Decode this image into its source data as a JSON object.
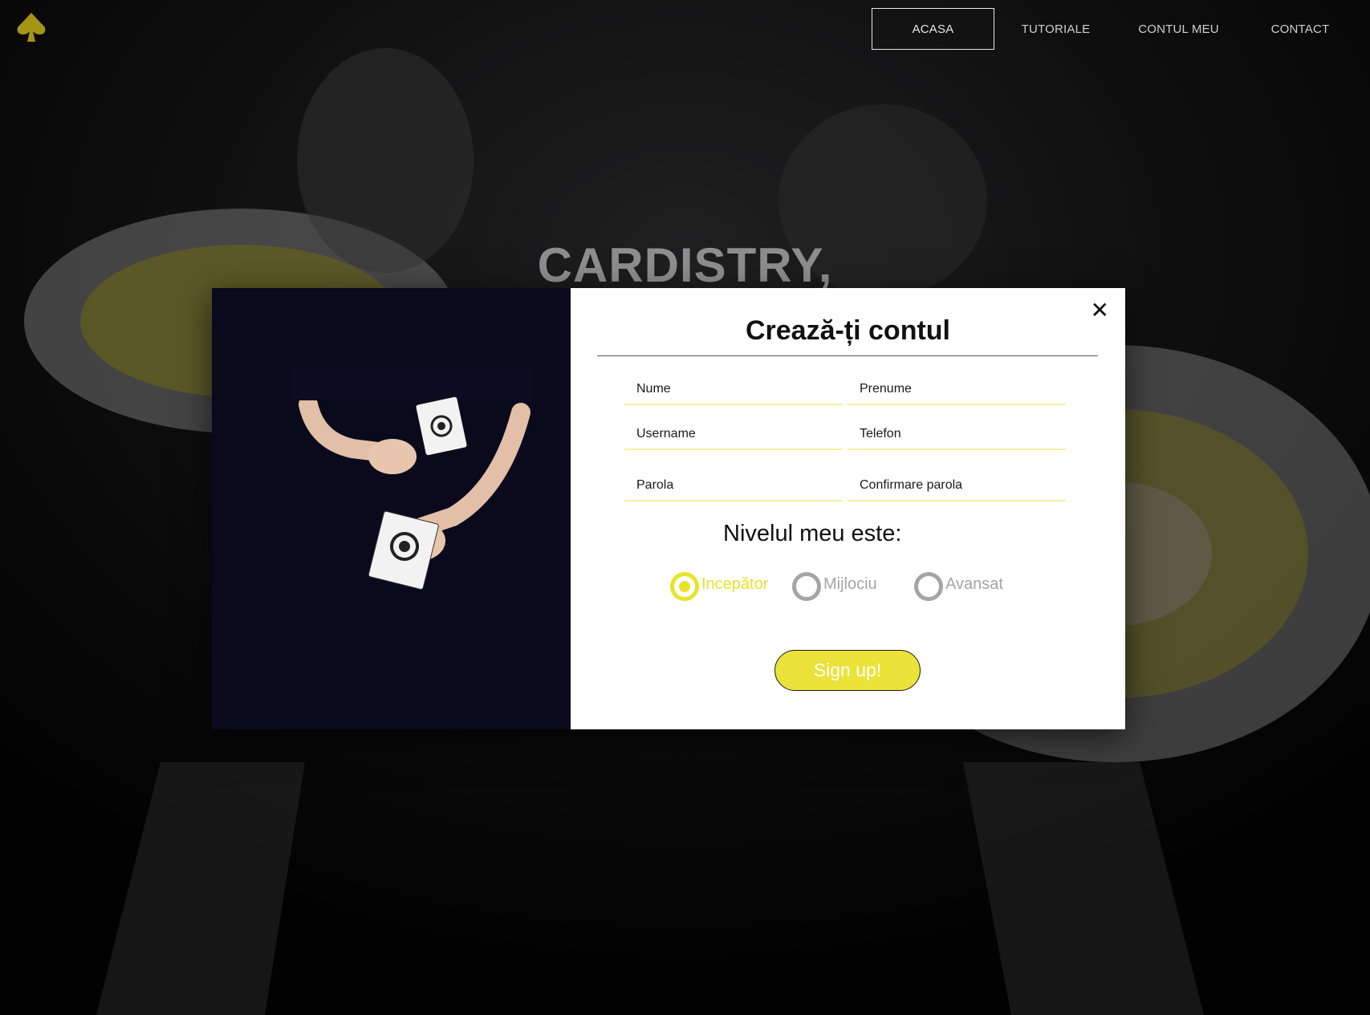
{
  "nav": {
    "logo": "spade-logo-icon",
    "items": [
      {
        "label": "ACASA",
        "active": true
      },
      {
        "label": "TUTORIALE",
        "active": false
      },
      {
        "label": "CONTUL MEU",
        "active": false
      },
      {
        "label": "CONTACT",
        "active": false
      }
    ]
  },
  "hero": {
    "title": "CARDISTRY,"
  },
  "modal": {
    "close_icon": "close-icon",
    "title": "Crează-ți contul",
    "fields": {
      "nume": "Nume",
      "prenume": "Prenume",
      "username": "Username",
      "telefon": "Telefon",
      "parola": "Parola",
      "confirmare": "Confirmare parola"
    },
    "level_heading": "Nivelul meu este:",
    "levels": [
      {
        "label": "Incepător",
        "selected": true
      },
      {
        "label": "Mijlociu",
        "selected": false
      },
      {
        "label": "Avansat",
        "selected": false
      }
    ],
    "submit_label": "Sign up!"
  },
  "colors": {
    "accent": "#e9e22b",
    "field_underline": "#f6ef9c",
    "radio_inactive": "#a5a5a5",
    "modal_image_bg": "#0a0a1c"
  }
}
